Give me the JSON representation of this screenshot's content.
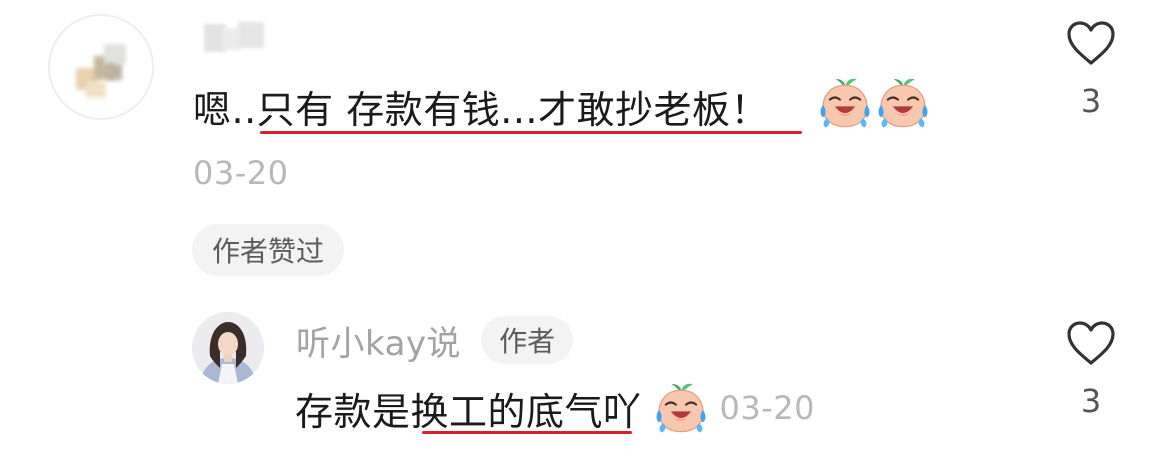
{
  "comment": {
    "username": "",
    "text": "嗯..只有 存款有钱...才敢抄老板！",
    "emojis": [
      "crying-laughing-peach-emoji",
      "crying-laughing-peach-emoji"
    ],
    "date": "03-20",
    "author_liked_label": "作者赞过",
    "like_count": "3"
  },
  "reply": {
    "username": "听小kay说",
    "author_tag": "作者",
    "text": "存款是换工的底气吖",
    "emoji": "crying-laughing-peach-emoji",
    "date": "03-20",
    "like_count": "3"
  },
  "colors": {
    "underline": "#d6202a",
    "secondary_text": "#b8b8b8",
    "tag_background": "#f3f3f3"
  }
}
